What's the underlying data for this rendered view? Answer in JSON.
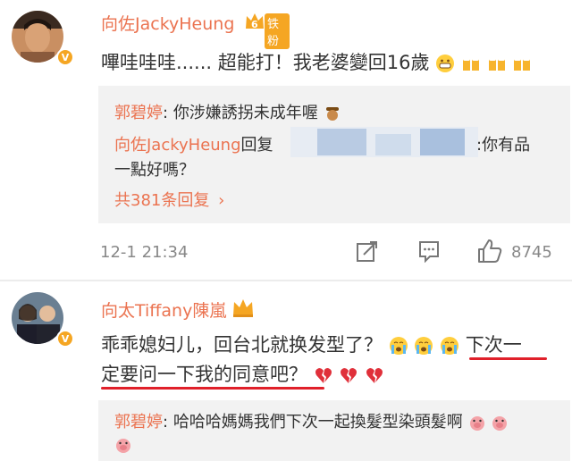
{
  "post1": {
    "username": "向佐JackyHeung",
    "fan_badge": {
      "level": "6",
      "label": "铁粉"
    },
    "text": "嗶哇哇哇...... 超能打！我老婆變回16歲",
    "emojis": [
      "grin-emoji",
      "beer-emoji",
      "beer-emoji",
      "beer-emoji"
    ],
    "replies": [
      {
        "author": "郭碧婷",
        "sep": ":",
        "text": "你涉嫌誘拐未成年喔",
        "emoji": "cowboy-emoji"
      },
      {
        "author": "向佐JackyHeung",
        "text_before": "回复",
        "text_after": ":你有品",
        "text_line2": "一點好嗎？"
      }
    ],
    "more_replies": "共381条回复",
    "time": "12-1 21:34",
    "like_count": "8745"
  },
  "post2": {
    "username": "向太Tiffany陳嵐",
    "text_line1": "乖乖媳妇儿，回台北就换发型了？",
    "text_line1_end": "下次一",
    "text_line2": "定要问一下我的同意吧？",
    "reply": {
      "author": "郭碧婷",
      "sep": ":",
      "text": "哈哈哈媽媽我們下次一起換髮型染頭髮啊"
    }
  },
  "colors": {
    "link": "#eb7350",
    "underline": "#e0202a",
    "badge": "#f5a623",
    "reply_bg": "#f2f2f2"
  }
}
